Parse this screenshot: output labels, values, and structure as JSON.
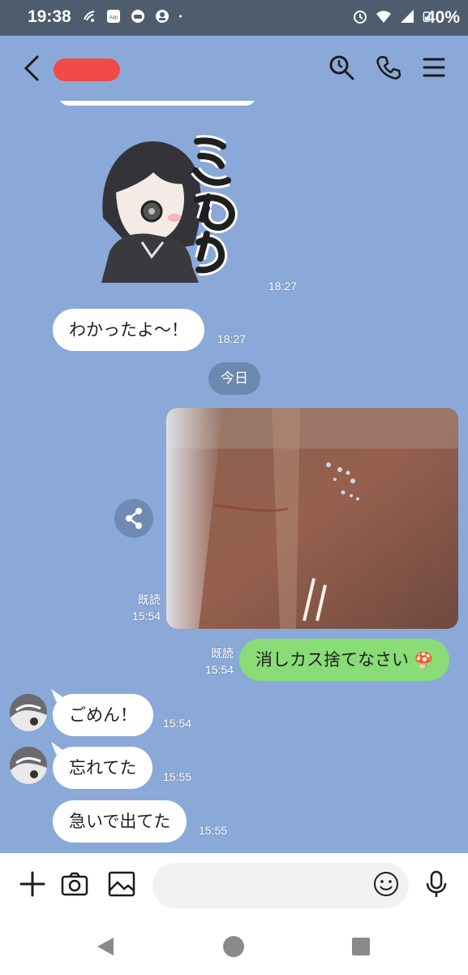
{
  "status_bar": {
    "time": "19:38",
    "battery_percent": "40%",
    "left_icons": [
      "wifi-calling-icon",
      "app-notification-icon",
      "game-icon",
      "headset-icon",
      "dot-icon"
    ],
    "right_icons": [
      "alarm-icon",
      "wifi-icon",
      "signal-icon",
      "battery-icon"
    ]
  },
  "header": {
    "contact_name_redacted": true,
    "actions": [
      "search-icon",
      "phone-icon",
      "menu-icon"
    ]
  },
  "messages": {
    "sticker": {
      "text": "ごめん",
      "time": "18:27"
    },
    "m1": {
      "text": "わかったよ〜！",
      "time": "18:27"
    },
    "date_divider": "今日",
    "photo": {
      "read": "既読",
      "time": "15:54"
    },
    "m2": {
      "text": "消しカス捨てなさい",
      "emoji": "🍄",
      "read": "既読",
      "time": "15:54"
    },
    "m3": {
      "text": "ごめん！",
      "time": "15:54"
    },
    "m4": {
      "text": "忘れてた",
      "time": "15:55"
    },
    "m5": {
      "text": "急いで出てた",
      "time": "15:55"
    }
  },
  "input_bar": {
    "placeholder": "",
    "buttons": [
      "plus-icon",
      "camera-icon",
      "image-icon",
      "emoji-icon",
      "mic-icon"
    ]
  },
  "nav_bar": [
    "back-nav-icon",
    "home-nav-icon",
    "recents-nav-icon"
  ],
  "colors": {
    "chat_background": "#8aa9d9",
    "outgoing_bubble": "#89dc76",
    "incoming_bubble": "#ffffff",
    "status_bar": "#4f5c6e"
  }
}
